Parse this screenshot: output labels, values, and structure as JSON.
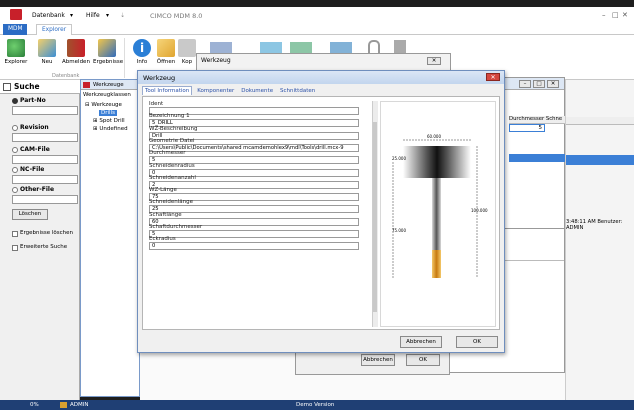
{
  "app": {
    "title": "CIMCO MDM 8.0",
    "menu": [
      "Datenbank",
      "Hilfe"
    ],
    "window_controls": [
      "–",
      "□",
      "✕"
    ]
  },
  "tabs": [
    "MDM",
    "Explorer"
  ],
  "ribbon": {
    "buttons": [
      {
        "label": "Explorer",
        "icon": "explorer-icon"
      },
      {
        "label": "Neu",
        "icon": "new-icon"
      },
      {
        "label": "Abmelden",
        "icon": "logout-icon"
      },
      {
        "label": "Ergebnisse",
        "icon": "results-icon"
      },
      {
        "label": "Info",
        "icon": "info-icon"
      },
      {
        "label": "Öffnen",
        "icon": "open-icon"
      },
      {
        "label": "Kop",
        "icon": "copy-icon"
      }
    ],
    "group_label": "Datenbank"
  },
  "search": {
    "title": "Suche",
    "fields": [
      "Part-No",
      "Revision",
      "CAM-File",
      "NC-File",
      "Other-File"
    ],
    "clear_button": "Löschen",
    "checkboxes": [
      "Ergebnisse löschen",
      "Erweiterte Suche"
    ]
  },
  "tool_tree": {
    "window_title": "Werkzeuge",
    "header": "Werkzeugklassen",
    "root": "Werkzeuge",
    "items": [
      "Drills",
      "Spot Drill",
      "Undefined"
    ]
  },
  "background_window": {
    "title": "Werkzeug",
    "columns": [
      "Durchmesser",
      "Schne"
    ],
    "cell_value": "5",
    "status_text": "3:48:11 AM Benutzer: ADMIN",
    "buttons": [
      "Abbrechen",
      "OK"
    ]
  },
  "dialog": {
    "title": "Werkzeug",
    "tabs": [
      "Tool Information",
      "Komponenter",
      "Dokumente",
      "Schnittdaten"
    ],
    "fields": [
      {
        "label": "Ident",
        "value": ""
      },
      {
        "label": "Bezeichnung 1",
        "value": "5_DRILL"
      },
      {
        "label": "WZ-Beschreibung",
        "value": "Drill"
      },
      {
        "label": "Geometrie Datei",
        "value": "C:\\Users\\Public\\Documents\\shared mcamdemohlex9\\mdl\\Tools\\drill.mcx-9"
      },
      {
        "label": "Durchmesser",
        "value": "5"
      },
      {
        "label": "Schneidenradius",
        "value": "0"
      },
      {
        "label": "Schneidenanzahl",
        "value": "2"
      },
      {
        "label": "WZ-Länge",
        "value": "75"
      },
      {
        "label": "Schneidenlänge",
        "value": "25"
      },
      {
        "label": "Schaftlänge",
        "value": "60"
      },
      {
        "label": "Schaftdurchmesser",
        "value": "5"
      },
      {
        "label": "Eckradius",
        "value": "0"
      }
    ],
    "preview": {
      "top_label": "60.000",
      "left_labels": [
        "25.000",
        "75.000"
      ],
      "right_label": "100.000"
    },
    "buttons": [
      "Abbrechen",
      "OK"
    ]
  },
  "statusbar": {
    "zoom": "0%",
    "user": "ADMIN",
    "center": "Demo Version"
  },
  "colors": {
    "accent": "#2b6cc4",
    "statusbar": "#1f3f74",
    "logo": "#c8202a",
    "close_button": "#d4473f"
  }
}
